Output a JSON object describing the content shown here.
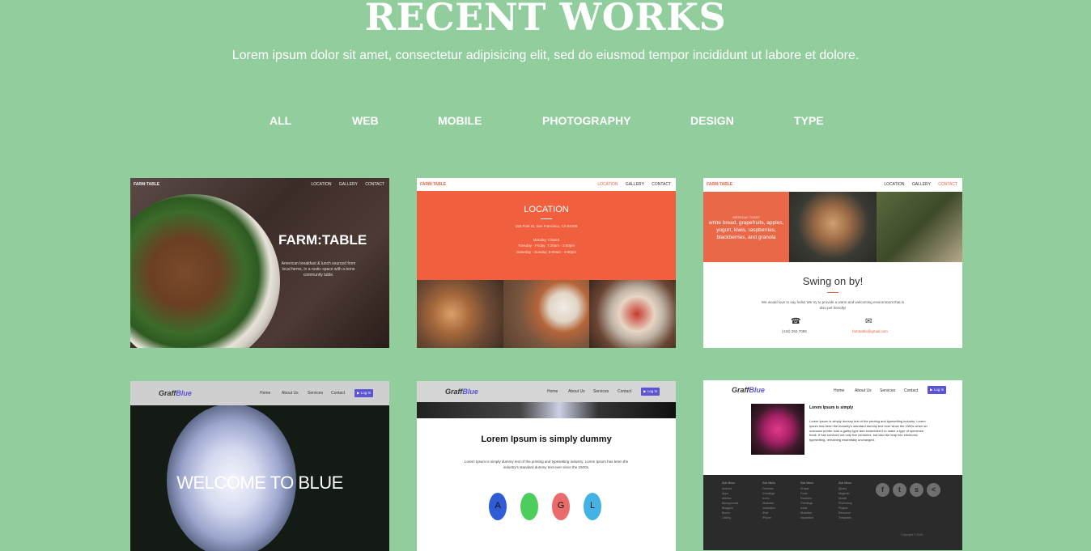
{
  "header": {
    "title": "RECENT WORKS",
    "subtitle": "Lorem ipsum dolor sit amet, consectetur adipisicing elit, sed do eiusmod tempor incididunt ut labore et dolore."
  },
  "filters": [
    "ALL",
    "WEB",
    "MOBILE",
    "PHOTOGRAPHY",
    "DESIGN",
    "TYPE"
  ],
  "colors": {
    "background": "#92ce9d",
    "accent_orange": "#f0603e",
    "accent_purple": "#5b55d6"
  },
  "cards": {
    "farm": {
      "nav_brand": "FARM:TABLE",
      "nav_links": [
        "LOCATION",
        "GALLERY",
        "CONTACT"
      ],
      "headline": "FARM:TABLE",
      "blurb": "American breakfast & lunch sourced from local farms, in a rustic space with a bone community table."
    },
    "location": {
      "nav_brand": "FARM:TABLE",
      "nav_links": [
        "LOCATION",
        "GALLERY",
        "CONTACT"
      ],
      "heading": "LOCATION",
      "address": "155 Post St, San Francisco, CA 94109",
      "hours_1": "Monday: Closed",
      "hours_2": "Tuesday - Friday: 7:30am - 3:00pm",
      "hours_3": "Saturday - Sunday: 8:00am - 3:00pm"
    },
    "swing": {
      "nav_brand": "FARM:TABLE",
      "nav_links": [
        "LOCATION",
        "GALLERY",
        "CONTACT"
      ],
      "banner_kicker": "WEEKDAY TOAST",
      "banner_text": "white bread, grapefruits, apples, yogurt, kiwis, raspberries, blackberries, and granola",
      "heading": "Swing on by!",
      "text": "We would love to say hello! We try to provide a warm and welcoming environment that is also pet friendly!",
      "phone": "(415) 292-7089",
      "email": "farmtable@gmail.com"
    },
    "blue_welcome": {
      "logo_a": "Graff",
      "logo_b": "Blue",
      "nav_links": [
        "Home",
        "About Us",
        "Services",
        "Contact"
      ],
      "login": "Log In",
      "welcome": "WELCOME TO BLUE"
    },
    "blue_dummy": {
      "logo_a": "Graff",
      "logo_b": "Blue",
      "nav_links": [
        "Home",
        "About Us",
        "Services",
        "Contact"
      ],
      "login": "Log In",
      "heading": "Lorem Ipsum is simply dummy",
      "text": "Lorem Ipsum is simply dummy text of the printing and typesetting industry. Lorem Ipsum has been the industry's standard dummy text ever since the 1500s.",
      "platforms": [
        {
          "name": "android-icon",
          "glyph": "A",
          "color": "#2f5bd4"
        },
        {
          "name": "apple-icon",
          "glyph": "",
          "color": "#4ccd5c"
        },
        {
          "name": "github-icon",
          "glyph": "G",
          "color": "#ea6b6b"
        },
        {
          "name": "linux-icon",
          "glyph": "L",
          "color": "#45b2e6"
        }
      ]
    },
    "blue_footer": {
      "logo_a": "Graff",
      "logo_b": "Blue",
      "nav_links": [
        "Home",
        "About Us",
        "Services",
        "Contact"
      ],
      "login": "Log In",
      "heading": "Lorem Ipsum is simply",
      "text": "Lorem Ipsum is simply dummy text of the printing and typesetting industry. Lorem Ipsum has been the industry's standard dummy text ever since the 1500s when an unknown printer took a galley type and scrambled it to make a type of specimen book. It has survived not only five centuries, but also the leap into electronic typesetting, remaining essentially unchanged.",
      "footer_cols": [
        {
          "head": "Sub Menu",
          "items": [
            "Android",
            "Apps",
            "Articles",
            "Backgrounds",
            "Bloggers",
            "Books",
            "Calling"
          ]
        },
        {
          "head": "Sub Menu",
          "items": [
            "Freebies",
            "Greetings",
            "Icons",
            "Illustrator",
            "Inspiration",
            "iPad",
            "iPhone"
          ]
        },
        {
          "head": "Sub Menu",
          "items": [
            "Drupal",
            "Fonts",
            "Freebies",
            "Greetings",
            "Icons",
            "Illustrator",
            "Inspiration"
          ]
        },
        {
          "head": "Sub Menu",
          "items": [
            "jQuery",
            "Magento",
            "Mobile",
            "Photoshop",
            "Plugins",
            "Resource",
            "Templates"
          ]
        }
      ],
      "social": [
        {
          "name": "facebook-icon",
          "glyph": "f"
        },
        {
          "name": "twitter-icon",
          "glyph": "t"
        },
        {
          "name": "snapchat-icon",
          "glyph": "s"
        },
        {
          "name": "share-icon",
          "glyph": "<"
        }
      ],
      "copyright": "Copyright © 2016"
    }
  }
}
